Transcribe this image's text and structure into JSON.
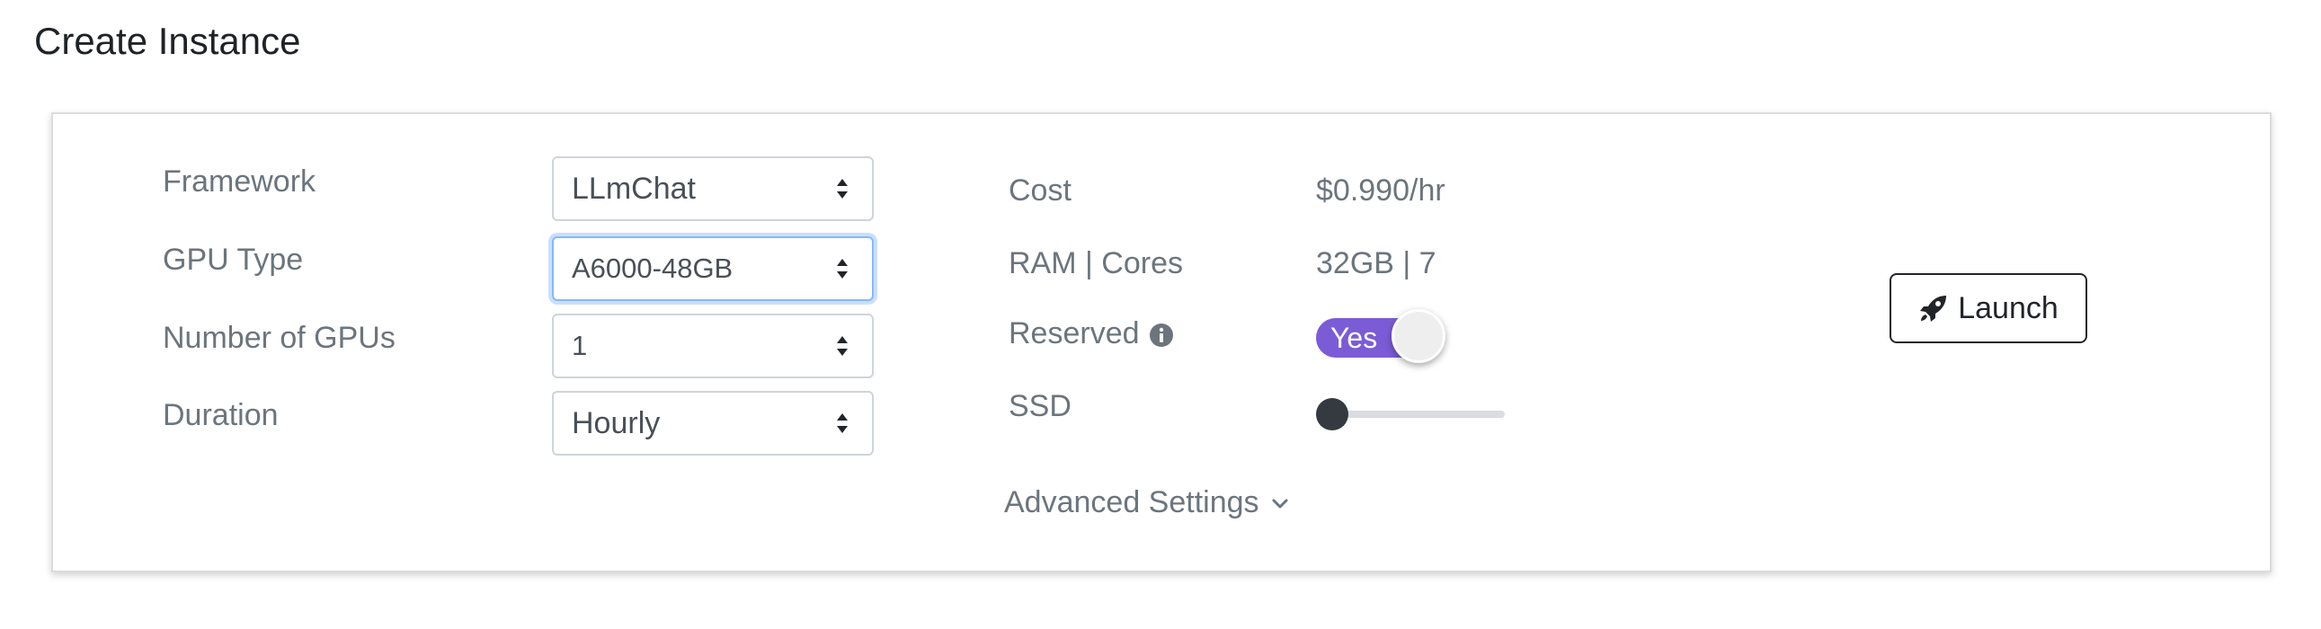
{
  "page": {
    "title": "Create Instance"
  },
  "form": {
    "framework": {
      "label": "Framework",
      "value": "LLmChat"
    },
    "gpu_type": {
      "label": "GPU Type",
      "value": "A6000-48GB"
    },
    "num_gpus": {
      "label": "Number of GPUs",
      "value": "1"
    },
    "duration": {
      "label": "Duration",
      "value": "Hourly"
    }
  },
  "summary": {
    "cost_label": "Cost",
    "cost_value": "$0.990/hr",
    "ram_label": "RAM | Cores",
    "ram_value": "32GB | 7",
    "reserved_label": "Reserved",
    "reserved_toggle_text": "Yes",
    "reserved_on": true,
    "ssd_label": "SSD",
    "ssd_level": 0
  },
  "advanced": {
    "label": "Advanced Settings"
  },
  "actions": {
    "launch_label": "Launch"
  },
  "colors": {
    "toggle_on": "#7b5cd6",
    "slider_thumb": "#343a40",
    "focus_ring": "#86b7fe"
  },
  "icons": {
    "select_caret": "caret-up-down-icon",
    "info": "info-circle-icon",
    "chevron": "chevron-down-icon",
    "launch": "rocket-icon"
  }
}
